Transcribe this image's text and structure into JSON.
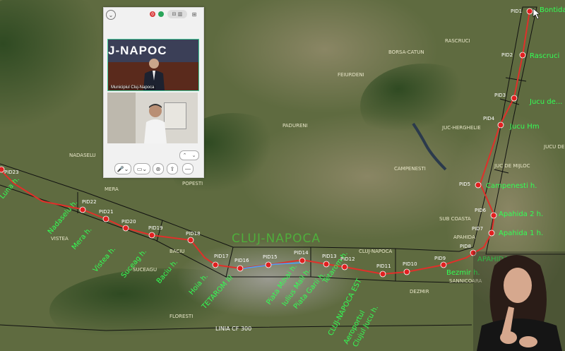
{
  "map": {
    "city_label": "CLUJ-NAPOCA",
    "line_label": "LINIA CF 300",
    "places": [
      {
        "name": "BORSA-CATUN"
      },
      {
        "name": "RASCRUCI"
      },
      {
        "name": "FEIURDENI"
      },
      {
        "name": "JUC-HERGHELIE"
      },
      {
        "name": "PADURENI"
      },
      {
        "name": "NADASELU"
      },
      {
        "name": "POPESTI"
      },
      {
        "name": "CAMPENESTI"
      },
      {
        "name": "MERA"
      },
      {
        "name": "VISTEA"
      },
      {
        "name": "BACIU"
      },
      {
        "name": "SUCEAGU"
      },
      {
        "name": "FLORESTI"
      },
      {
        "name": "SUB COASTA"
      },
      {
        "name": "APAHIDA"
      },
      {
        "name": "CLUJ-NAPOCA"
      },
      {
        "name": "DEZMIR"
      },
      {
        "name": "SANNICOARA"
      },
      {
        "name": "JUC DE MIJLOC"
      },
      {
        "name": "JUCU DE SUS"
      }
    ],
    "stations": [
      {
        "name": "Bontida"
      },
      {
        "name": "Rascruci"
      },
      {
        "name": "Jucu de..."
      },
      {
        "name": "Jucu Hm"
      },
      {
        "name": "Campenesti h."
      },
      {
        "name": "Apahida 2 h."
      },
      {
        "name": "Apahida 1 h."
      },
      {
        "name": "APAHIDA"
      },
      {
        "name": "Bezmir h."
      },
      {
        "name": "CLUJ-NAPOCA EST"
      },
      {
        "name": "Aeroportul"
      },
      {
        "name": "Clujul Jucu h."
      },
      {
        "name": "Tetarom h."
      },
      {
        "name": "Piata Mihai h."
      },
      {
        "name": "Iulius Mall h."
      },
      {
        "name": "Piata Garii h."
      },
      {
        "name": "TETAROM III"
      },
      {
        "name": "Hoia h."
      },
      {
        "name": "Baciu h."
      },
      {
        "name": "Suceag h."
      },
      {
        "name": "Vistea h."
      },
      {
        "name": "Mera h."
      },
      {
        "name": "Nadaselu h."
      },
      {
        "name": "Gilau"
      },
      {
        "name": "Luna h."
      }
    ],
    "pids": [
      "PID1",
      "PID2",
      "PID3",
      "PID4",
      "PID5",
      "PID6",
      "PID7",
      "PID8",
      "PID9",
      "PID10",
      "PID11",
      "PID12",
      "PID13",
      "PID14",
      "PID15",
      "PID16",
      "PID17",
      "PID18",
      "PID19",
      "PID20",
      "PID21",
      "PID22",
      "PID23"
    ],
    "colors": {
      "route": "#e0302a",
      "station_text": "#33ff55",
      "terrain": "#5c6a3e",
      "corridor": "#111111"
    }
  },
  "call": {
    "collapse_icon": "chevron-down-icon",
    "recording_count": "0",
    "view_toggle": "⊟ ▥",
    "grid_icon": "grid-icon",
    "tile1_banner": "J-NAPOC",
    "tile1_name": "Municipiul Cluj-Napoca",
    "scroll_up": "⌃",
    "scroll_down": "⌄",
    "controls": [
      {
        "icon": "microphone-icon",
        "label": "🎤⌄"
      },
      {
        "icon": "camera-icon",
        "label": "▭⌄"
      },
      {
        "icon": "settings-icon",
        "label": "⊛"
      },
      {
        "icon": "share-icon",
        "label": "⇪"
      },
      {
        "icon": "leave-icon",
        "label": "—"
      }
    ]
  },
  "cursor_icon": "mouse-pointer-icon"
}
